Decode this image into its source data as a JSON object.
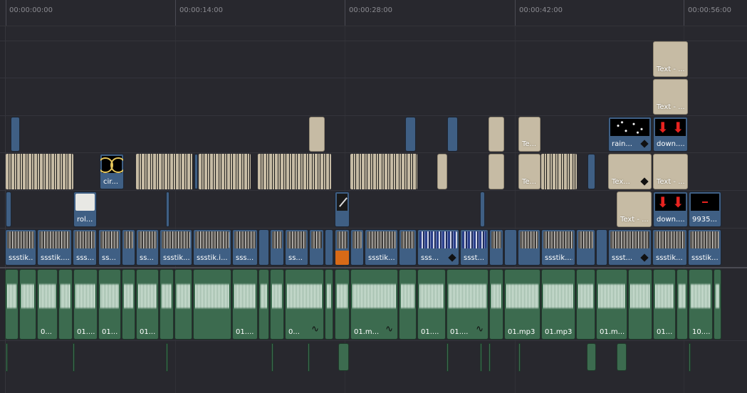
{
  "ruler": {
    "timecodes": [
      "00:00:00:00",
      "00:00:14:00",
      "00:00:28:00",
      "00:00:42:00",
      "00:00:56:00"
    ]
  },
  "tracks": {
    "v6": [
      {
        "label": "Text - ..."
      }
    ],
    "v5": [
      {
        "label": "Text - ..."
      }
    ],
    "v4": [
      {
        "label": "Te..."
      },
      {
        "label": "rain...",
        "icon": "keyframe-icon"
      },
      {
        "label": "down...."
      }
    ],
    "v3": [
      {
        "label": "cir..."
      },
      {
        "label": "Te..."
      },
      {
        "label": "Tex...",
        "icon": "keyframe-icon"
      },
      {
        "label": "Text - ..."
      }
    ],
    "v2": [
      {
        "label": "rol..."
      },
      {
        "label": "Text - ..."
      },
      {
        "label": "down...."
      },
      {
        "label": "9935..."
      }
    ],
    "v1": [
      {
        "label": "ssstik..."
      },
      {
        "label": "ssstik...."
      },
      {
        "label": "sss..."
      },
      {
        "label": "ss..."
      },
      {
        "label": "ss..."
      },
      {
        "label": "ssstik..."
      },
      {
        "label": "ssstik.i..."
      },
      {
        "label": "sss..."
      },
      {
        "label": "ss..."
      },
      {
        "label": "ssstik...."
      },
      {
        "label": "sss..."
      },
      {
        "label": "ssst..."
      },
      {
        "label": "ssstik...."
      },
      {
        "label": "sss..."
      },
      {
        "label": "ssst..."
      },
      {
        "label": "ssstik..."
      },
      {
        "label": "ssstik..."
      }
    ],
    "a1": [
      {
        "label": "0..."
      },
      {
        "label": "01...."
      },
      {
        "label": "01...."
      },
      {
        "label": "01...."
      },
      {
        "label": "01...."
      },
      {
        "label": "0..."
      },
      {
        "label": "01.m..."
      },
      {
        "label": "01...."
      },
      {
        "label": "01...."
      },
      {
        "label": "01.mp3"
      },
      {
        "label": "01.mp3"
      },
      {
        "label": "01.m..."
      },
      {
        "label": "01...."
      },
      {
        "label": "10...."
      }
    ]
  },
  "colors": {
    "background": "#28282e",
    "video_clip": "#3f5f84",
    "title_clip": "#c6bba4",
    "audio_clip": "#3c6b4f",
    "waveform": "#e6f4ea",
    "selected_clip": "#d86a17"
  }
}
